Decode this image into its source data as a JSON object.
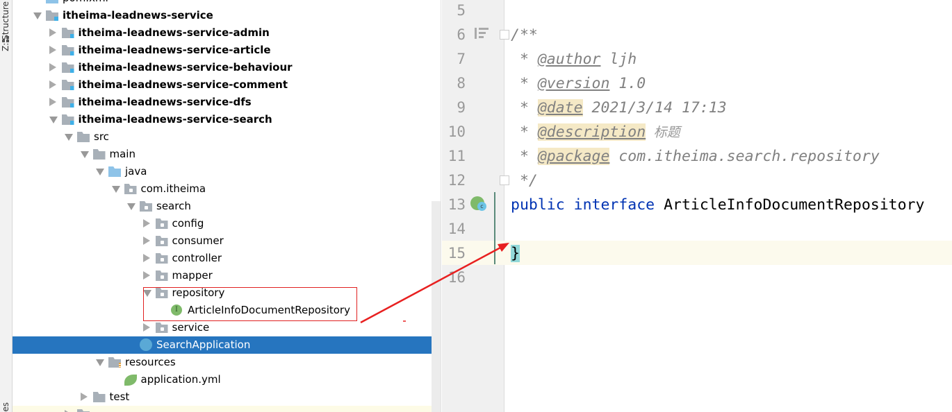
{
  "sidebar": {
    "structure_label": "Z: Structure",
    "bottom_label": "es"
  },
  "tree": [
    {
      "label": "pom.xml",
      "level": 0,
      "icon": "xml-file-icon",
      "arrow": "none",
      "bold": false
    },
    {
      "label": "itheima-leadnews-service",
      "level": 0,
      "icon": "module-folder-icon",
      "arrow": "down",
      "bold": true
    },
    {
      "label": "itheima-leadnews-service-admin",
      "level": 1,
      "icon": "module-folder-icon",
      "arrow": "right",
      "bold": true
    },
    {
      "label": "itheima-leadnews-service-article",
      "level": 1,
      "icon": "module-folder-icon",
      "arrow": "right",
      "bold": true
    },
    {
      "label": "itheima-leadnews-service-behaviour",
      "level": 1,
      "icon": "module-folder-icon",
      "arrow": "right",
      "bold": true
    },
    {
      "label": "itheima-leadnews-service-comment",
      "level": 1,
      "icon": "module-folder-icon",
      "arrow": "right",
      "bold": true
    },
    {
      "label": "itheima-leadnews-service-dfs",
      "level": 1,
      "icon": "module-folder-icon",
      "arrow": "right",
      "bold": true
    },
    {
      "label": "itheima-leadnews-service-search",
      "level": 1,
      "icon": "module-folder-icon",
      "arrow": "down",
      "bold": true
    },
    {
      "label": "src",
      "level": 2,
      "icon": "folder-icon",
      "arrow": "down",
      "bold": false
    },
    {
      "label": "main",
      "level": 3,
      "icon": "folder-icon",
      "arrow": "down",
      "bold": false
    },
    {
      "label": "java",
      "level": 4,
      "icon": "source-folder-icon",
      "arrow": "down",
      "bold": false
    },
    {
      "label": "com.itheima",
      "level": 5,
      "icon": "package-icon",
      "arrow": "down",
      "bold": false
    },
    {
      "label": "search",
      "level": 6,
      "icon": "package-icon",
      "arrow": "down",
      "bold": false
    },
    {
      "label": "config",
      "level": 7,
      "icon": "package-icon",
      "arrow": "right",
      "bold": false
    },
    {
      "label": "consumer",
      "level": 7,
      "icon": "package-icon",
      "arrow": "right",
      "bold": false
    },
    {
      "label": "controller",
      "level": 7,
      "icon": "package-icon",
      "arrow": "right",
      "bold": false
    },
    {
      "label": "mapper",
      "level": 7,
      "icon": "package-icon",
      "arrow": "right",
      "bold": false
    },
    {
      "label": "repository",
      "level": 7,
      "icon": "package-icon",
      "arrow": "down",
      "bold": false
    },
    {
      "label": "ArticleInfoDocumentRepository",
      "level": 8,
      "icon": "interface-icon",
      "arrow": "none",
      "bold": false
    },
    {
      "label": "service",
      "level": 7,
      "icon": "package-icon",
      "arrow": "right",
      "bold": false
    },
    {
      "label": "SearchApplication",
      "level": 6,
      "icon": "spring-boot-class-icon",
      "arrow": "none",
      "bold": false,
      "selected": true
    },
    {
      "label": "resources",
      "level": 4,
      "icon": "resources-folder-icon",
      "arrow": "down",
      "bold": false
    },
    {
      "label": "application.yml",
      "level": 5,
      "icon": "spring-yml-icon",
      "arrow": "none",
      "bold": false
    },
    {
      "label": "test",
      "level": 3,
      "icon": "folder-icon",
      "arrow": "right",
      "bold": false
    },
    {
      "label": "",
      "level": 2,
      "icon": "folder-icon",
      "arrow": "right",
      "bold": false,
      "highlight": true
    }
  ],
  "editor": {
    "lines": [
      "5",
      "6",
      "7",
      "8",
      "9",
      "10",
      "11",
      "12",
      "13",
      "14",
      "15",
      "16"
    ],
    "code": {
      "l6": "/**",
      "l7_star": " * ",
      "l7_tag": "@author",
      "l7_val": " ljh",
      "l8_star": " * ",
      "l8_tag": "@version",
      "l8_val": " 1.0",
      "l9_star": " * ",
      "l9_tag": "@date",
      "l9_val": " 2021/3/14 17:13",
      "l10_star": " * ",
      "l10_tag": "@description",
      "l10_val": " 标题",
      "l11_star": " * ",
      "l11_tag": "@package",
      "l11_val": " com.itheima.search.repository",
      "l12": " */",
      "l13_kw1": "public",
      "l13_kw2": "interface",
      "l13_name": "ArticleInfoDocumentRepository",
      "l15": "}"
    }
  },
  "colors": {
    "selection": "#2675bf",
    "keyword": "#0033b3",
    "annotation_box": "#e02020",
    "tag_highlight": "#f5e9c6"
  }
}
